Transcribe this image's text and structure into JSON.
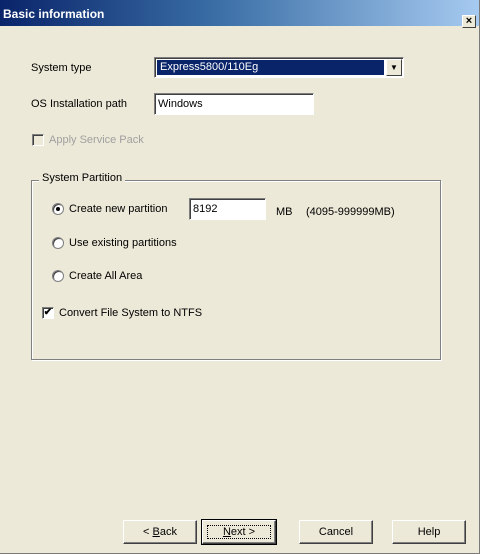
{
  "window": {
    "title": "Basic information",
    "close_glyph": "×"
  },
  "fields": {
    "system_type": {
      "label": "System type",
      "value": "Express5800/110Eg"
    },
    "os_path": {
      "label": "OS Installation path",
      "value": "Windows"
    },
    "apply_service_pack": {
      "label": "Apply Service Pack",
      "checked": false,
      "enabled": false
    }
  },
  "system_partition": {
    "title": "System Partition",
    "create_new": {
      "label": "Create new partition",
      "selected": true,
      "size_value": "8192",
      "unit": "MB",
      "range": "(4095-999999MB)"
    },
    "use_existing": {
      "label": "Use existing partitions",
      "selected": false
    },
    "create_all": {
      "label": "Create All Area",
      "selected": false
    },
    "convert_ntfs": {
      "label": "Convert File System to NTFS",
      "checked": true
    }
  },
  "buttons": {
    "back_prefix": "< ",
    "back_underlined": "B",
    "back_rest": "ack",
    "next_underlined": "N",
    "next_rest": "ext >",
    "cancel": "Cancel",
    "help": "Help"
  },
  "icons": {
    "checkmark": "✔",
    "dropdown_arrow": "▼"
  }
}
